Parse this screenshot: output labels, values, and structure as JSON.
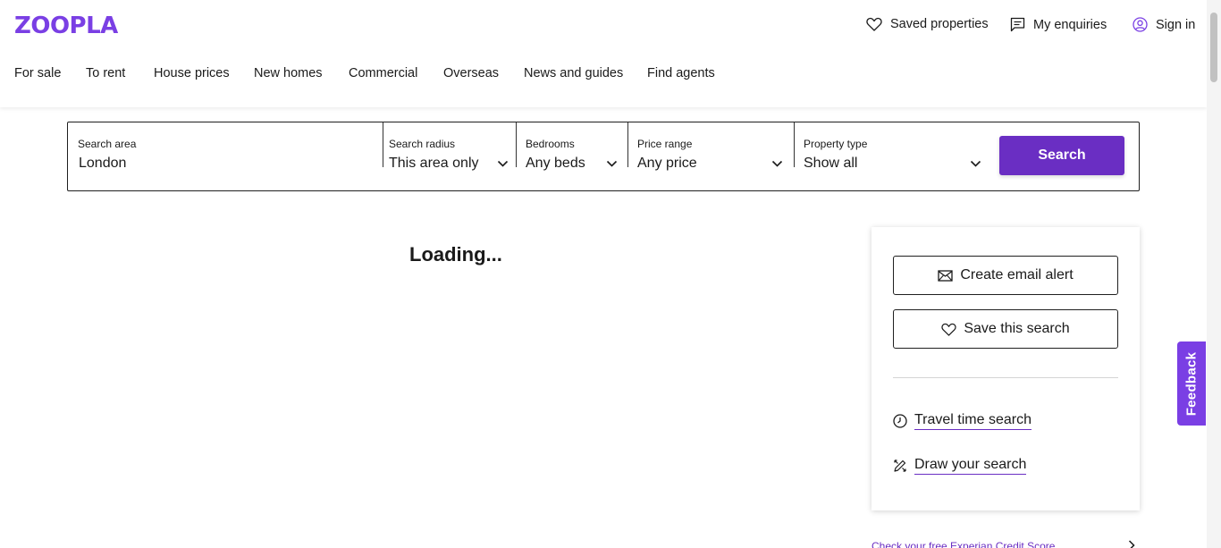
{
  "header": {
    "logo": "ZOOPLA",
    "saved_properties": "Saved properties",
    "my_enquiries": "My enquiries",
    "sign_in": "Sign in"
  },
  "nav": {
    "for_sale": "For sale",
    "to_rent": "To rent",
    "house_prices": "House prices",
    "new_homes": "New homes",
    "commercial": "Commercial",
    "overseas": "Overseas",
    "news_and_guides": "News and guides",
    "find_agents": "Find agents"
  },
  "search": {
    "area_label": "Search area",
    "area_value": "London",
    "radius_label": "Search radius",
    "radius_value": "This area only",
    "bedrooms_label": "Bedrooms",
    "bedrooms_value": "Any beds",
    "price_label": "Price range",
    "price_value": "Any price",
    "type_label": "Property type",
    "type_value": "Show all",
    "button": "Search"
  },
  "main": {
    "loading": "Loading..."
  },
  "panel": {
    "email_alert": "Create email alert",
    "save_search": "Save this search",
    "travel_time": "Travel time search",
    "draw_search": "Draw your search"
  },
  "footer_link": "Check your free Experian Credit Score",
  "feedback": "Feedback",
  "colors": {
    "brand": "#7a3fe4",
    "button": "#6a2ec3"
  }
}
